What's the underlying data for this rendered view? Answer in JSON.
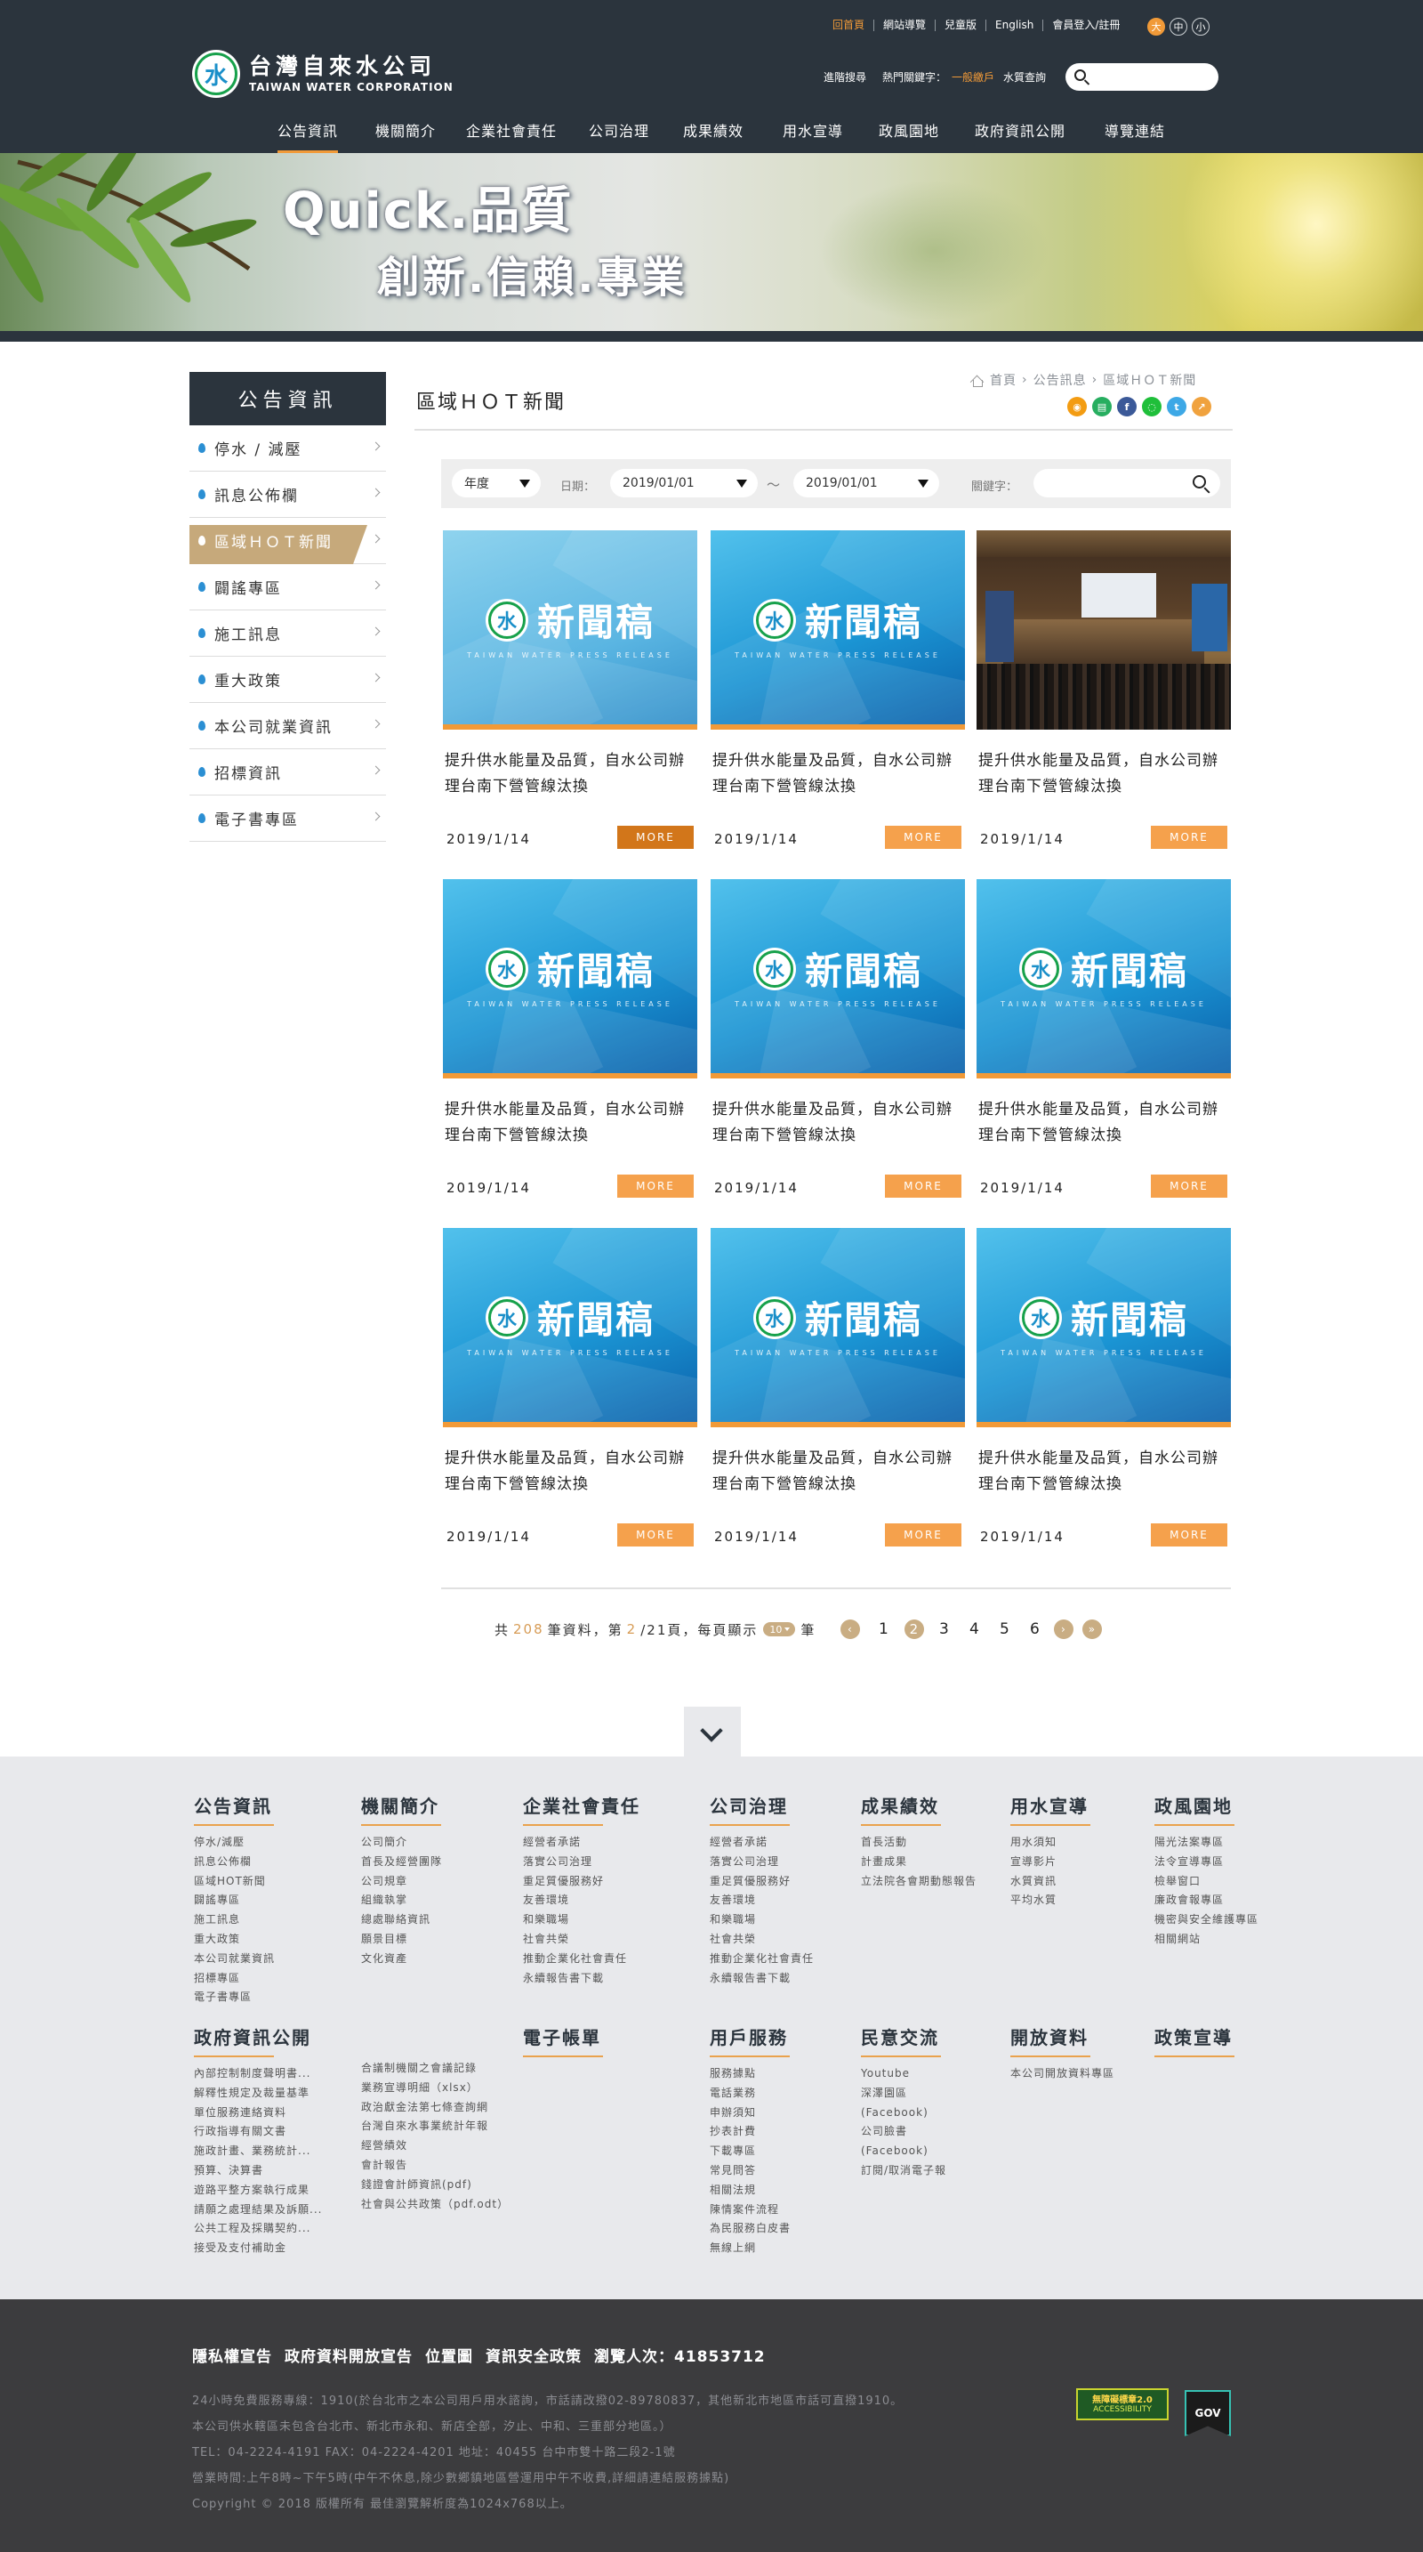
{
  "header": {
    "logo_zh": "台灣自來水公司",
    "logo_en": "TAIWAN WATER CORPORATION",
    "logo_glyph": "水",
    "top_links": [
      "回首頁",
      "網站導覽",
      "兒童版",
      "English",
      "會員登入/註冊"
    ],
    "font_sizes": [
      "大",
      "中",
      "小"
    ],
    "advanced_search": "進階搜尋",
    "hot_keywords_label": "熱門關鍵字：",
    "hot_keyword_1": "一般繳戶",
    "hot_keyword_2": "水質查詢",
    "search_placeholder": "",
    "nav": [
      "公告資訊",
      "機關簡介",
      "企業社會責任",
      "公司治理",
      "成果績效",
      "用水宣導",
      "政風園地",
      "政府資訊公開",
      "導覽連結"
    ],
    "accent_color": "#f19a38"
  },
  "banner": {
    "line1": "Quick.品質",
    "line2": "創新.信賴.專業"
  },
  "sidebar": {
    "title": "公告資訊",
    "items": [
      "停水 / 減壓",
      "訊息公佈欄",
      "區域ＨＯＴ新聞",
      "闢謠專區",
      "施工訊息",
      "重大政策",
      "本公司就業資訊",
      "招標資訊",
      "電子書專區"
    ],
    "active_index": 2
  },
  "page": {
    "title": "區域ＨＯＴ新聞",
    "breadcrumb": [
      "首頁",
      "公告訊息",
      "區域ＨＯＴ新聞"
    ],
    "share_icons": [
      "rss-icon",
      "print-icon",
      "facebook-icon",
      "line-icon",
      "twitter-icon",
      "share-icon"
    ]
  },
  "filter": {
    "year_label": "年度",
    "date_label": "日期：",
    "date_from": "2019/01/01",
    "tilde": "～",
    "date_to": "2019/01/01",
    "keyword_label": "關鍵字：",
    "keyword_value": ""
  },
  "news": [
    {
      "image": "press-light",
      "title": "提升供水能量及品質，自水公司辦理台南下營管線汰換",
      "date": "2019/1/14",
      "more": "MORE"
    },
    {
      "image": "press-blue",
      "title": "提升供水能量及品質，自水公司辦理台南下營管線汰換",
      "date": "2019/1/14",
      "more": "MORE"
    },
    {
      "image": "photo",
      "title": "提升供水能量及品質，自水公司辦理台南下營管線汰換",
      "date": "2019/1/14",
      "more": "MORE"
    },
    {
      "image": "press-blue",
      "title": "提升供水能量及品質，自水公司辦理台南下營管線汰換",
      "date": "2019/1/14",
      "more": "MORE"
    },
    {
      "image": "press-blue",
      "title": "提升供水能量及品質，自水公司辦理台南下營管線汰換",
      "date": "2019/1/14",
      "more": "MORE"
    },
    {
      "image": "press-blue",
      "title": "提升供水能量及品質，自水公司辦理台南下營管線汰換",
      "date": "2019/1/14",
      "more": "MORE"
    },
    {
      "image": "press-blue",
      "title": "提升供水能量及品質，自水公司辦理台南下營管線汰換",
      "date": "2019/1/14",
      "more": "MORE"
    },
    {
      "image": "press-blue",
      "title": "提升供水能量及品質，自水公司辦理台南下營管線汰換",
      "date": "2019/1/14",
      "more": "MORE"
    },
    {
      "image": "press-blue",
      "title": "提升供水能量及品質，自水公司辦理台南下營管線汰換",
      "date": "2019/1/14",
      "more": "MORE"
    }
  ],
  "press_text": "新聞稿",
  "press_sub": "TAIWAN WATER PRESS RELEASE",
  "pager": {
    "prefix": "共",
    "total": "208",
    "records": "筆資料，第",
    "page": "2",
    "of": "/21頁，每頁顯示",
    "per_page": "10",
    "suffix": "筆",
    "pages": [
      "1",
      "2",
      "3",
      "4",
      "5",
      "6"
    ],
    "current": "2"
  },
  "footer": {
    "columns": [
      {
        "title": "公告資訊",
        "items": [
          "停水/減壓",
          "訊息公佈欄",
          "區域HOT新聞",
          "闢謠專區",
          "施工訊息",
          "重大政策",
          "本公司就業資訊",
          "招標專區",
          "電子書專區"
        ]
      },
      {
        "title": "機關簡介",
        "items": [
          "公司簡介",
          "首長及經營團隊",
          "公司規章",
          "組織執掌",
          "總處聯絡資訊",
          "願景目標",
          "文化資產"
        ]
      },
      {
        "title": "企業社會責任",
        "items": [
          "經營者承諾",
          "落實公司治理",
          "重足質優服務好",
          "友善環境",
          "和樂職場",
          "社會共榮",
          "推動企業化社會責任",
          "永續報告書下載"
        ]
      },
      {
        "title": "公司治理",
        "items": [
          "經營者承諾",
          "落實公司治理",
          "重足質優服務好",
          "友善環境",
          "和樂職場",
          "社會共榮",
          "推動企業化社會責任",
          "永續報告書下載"
        ]
      },
      {
        "title": "成果績效",
        "items": [
          "首長活動",
          "計畫成果",
          "立法院各會期動態報告"
        ]
      },
      {
        "title": "用水宣導",
        "items": [
          "用水須知",
          "宣導影片",
          "水質資訊",
          "平均水質"
        ]
      },
      {
        "title": "政風園地",
        "items": [
          "陽光法案專區",
          "法令宣導專區",
          "檢舉窗口",
          "廉政會報專區",
          "機密與安全維護專區",
          "相關網站"
        ]
      },
      {
        "title": "政府資訊公開",
        "items": [
          "內部控制制度聲明書...",
          "解釋性規定及裁量基準",
          "單位服務連絡資料",
          "行政指導有關文書",
          "施政計畫、業務統計...",
          "預算、決算書",
          "遊路平整方案執行成果",
          "請願之處理結果及訴願...",
          "公共工程及採購契約...",
          "接受及支付補助金"
        ]
      },
      {
        "title": "",
        "items": [
          "合議制機關之會議記錄",
          "業務宣導明細（xlsx）",
          "政治獻金法第七條查詢網",
          "台灣自來水事業統計年報",
          "經營績效",
          "會計報告",
          "錢證會計師資訊(pdf)",
          "社會與公共政策（pdf.odt）"
        ]
      },
      {
        "title": "電子帳單",
        "items": []
      },
      {
        "title": "用戶服務",
        "items": [
          "服務據點",
          "電話業務",
          "申辦須知",
          "抄表計費",
          "下載專區",
          "常見問答",
          "相關法規",
          "陳情案件流程",
          "為民服務白皮書",
          "無線上網"
        ]
      },
      {
        "title": "民意交流",
        "items": [
          "Youtube",
          "深澤園區",
          "(Facebook)",
          "公司臉書",
          "(Facebook)",
          "訂閱/取消電子報"
        ]
      },
      {
        "title": "開放資料",
        "items": [
          "本公司開放資料專區"
        ]
      },
      {
        "title": "政策宣導",
        "items": []
      }
    ],
    "bottom_links": [
      "隱私權宣告",
      "政府資料開放宣告",
      "位置圖",
      "資訊安全政策",
      "瀏覽人次：41853712"
    ],
    "info_lines": [
      "24小時免費服務專線：1910(於台北市之本公司用戶用水諮詢，市話請改撥02-89780837，其他新北市地區市話可直撥1910。",
      "本公司供水轄區未包含台北市、新北市永和、新店全部，汐止、中和、三重部分地區。）",
      "TEL：04-2224-4191   FAX：04-2224-4201   地址：40455 台中市雙十路二段2-1號",
      "營業時間:上午8時~下午5時(中午不休息,除少數鄉鎮地區營運用中午不收費,詳細請連結服務據點)",
      "Copyright © 2018 版權所有 最佳瀏覽解析度為1024x768以上。"
    ],
    "badge_accessibility": "無障礙標章2.0",
    "badge_accessibility_sub": "ACCESSIBILITY",
    "badge_gov": "GOV"
  }
}
